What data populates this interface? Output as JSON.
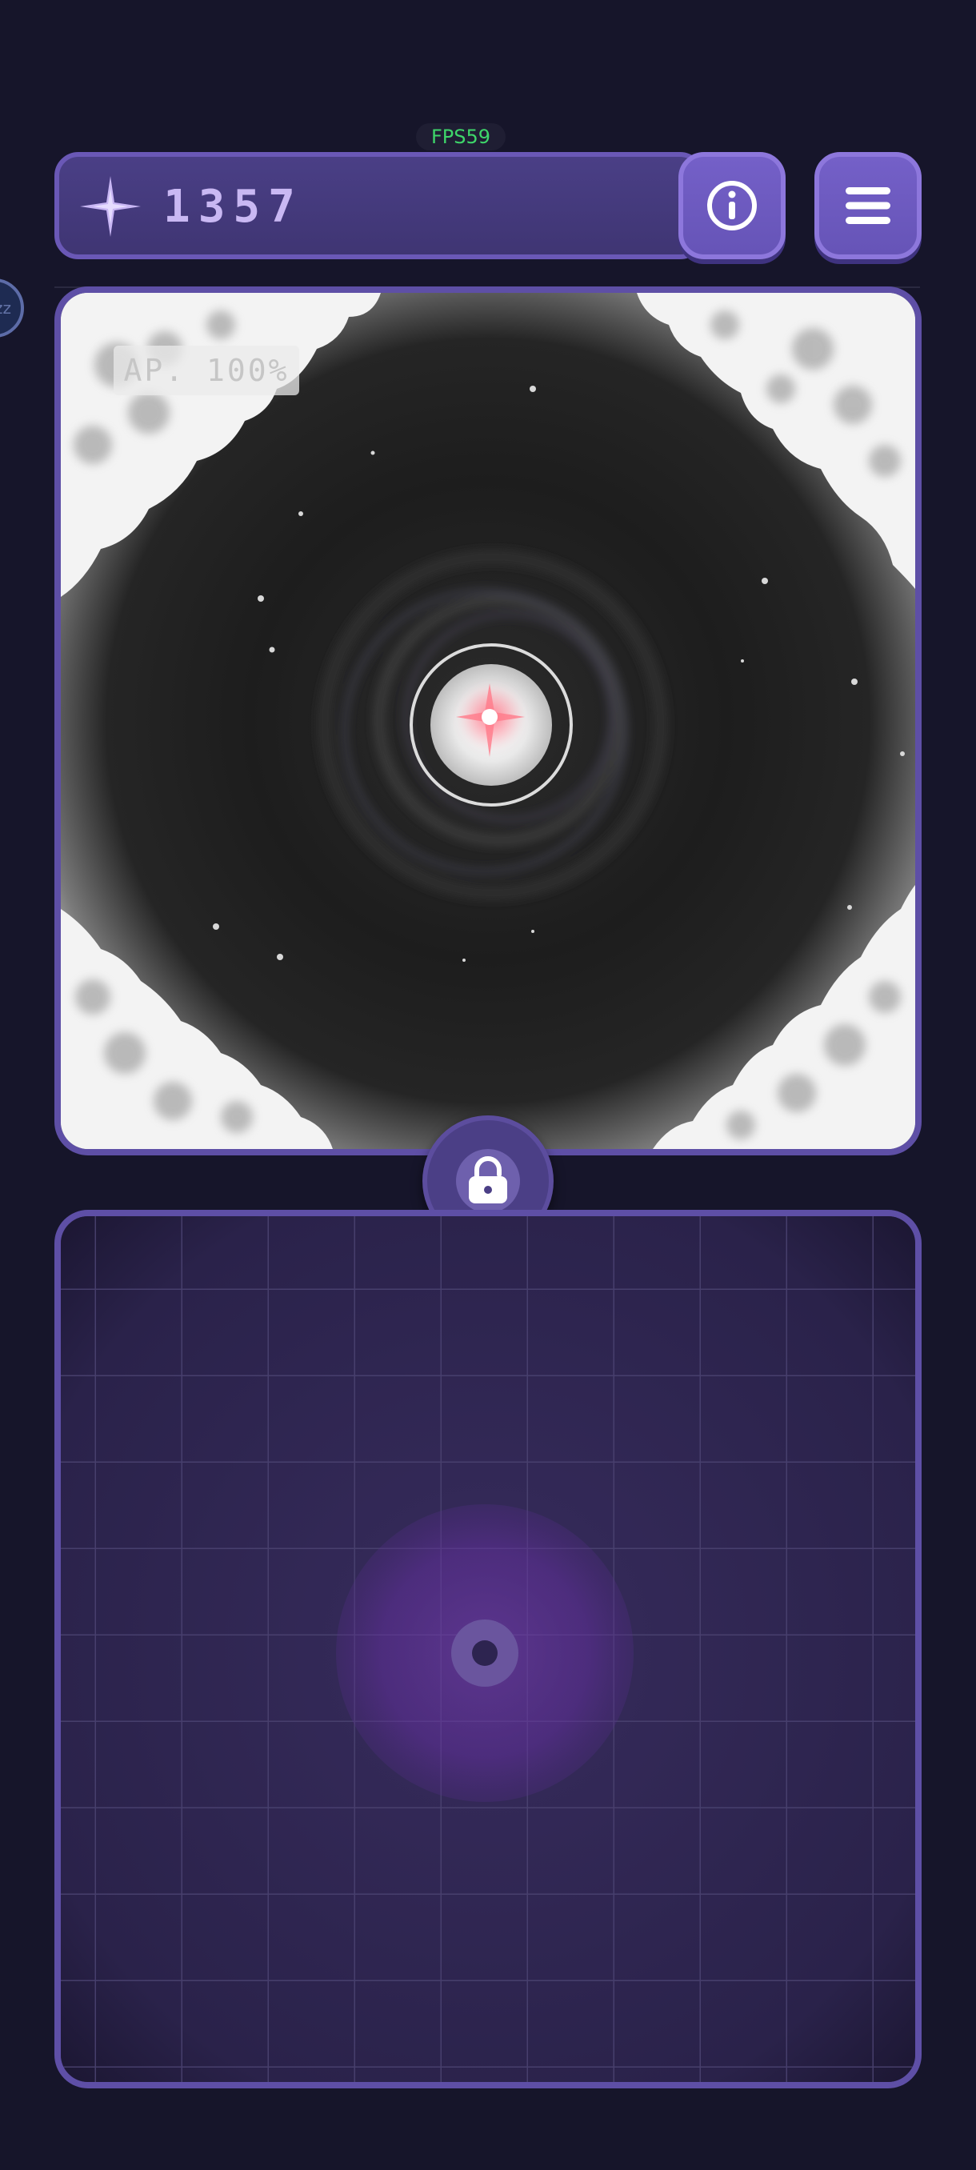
{
  "hud": {
    "fps_label": "FPS59",
    "score": "1357",
    "star_icon": "star-icon",
    "info_icon": "info-icon",
    "menu_icon": "hamburger-menu-icon"
  },
  "side_badge": {
    "label": "zz"
  },
  "viewport": {
    "ap_label": "AP. 100%"
  },
  "lock": {
    "icon": "lock-icon"
  },
  "colors": {
    "background": "#16152a",
    "panel_border": "#5e4fa6",
    "button": "#7460c8",
    "fps_green": "#3ed66a",
    "score_text": "#c9b8f3"
  }
}
